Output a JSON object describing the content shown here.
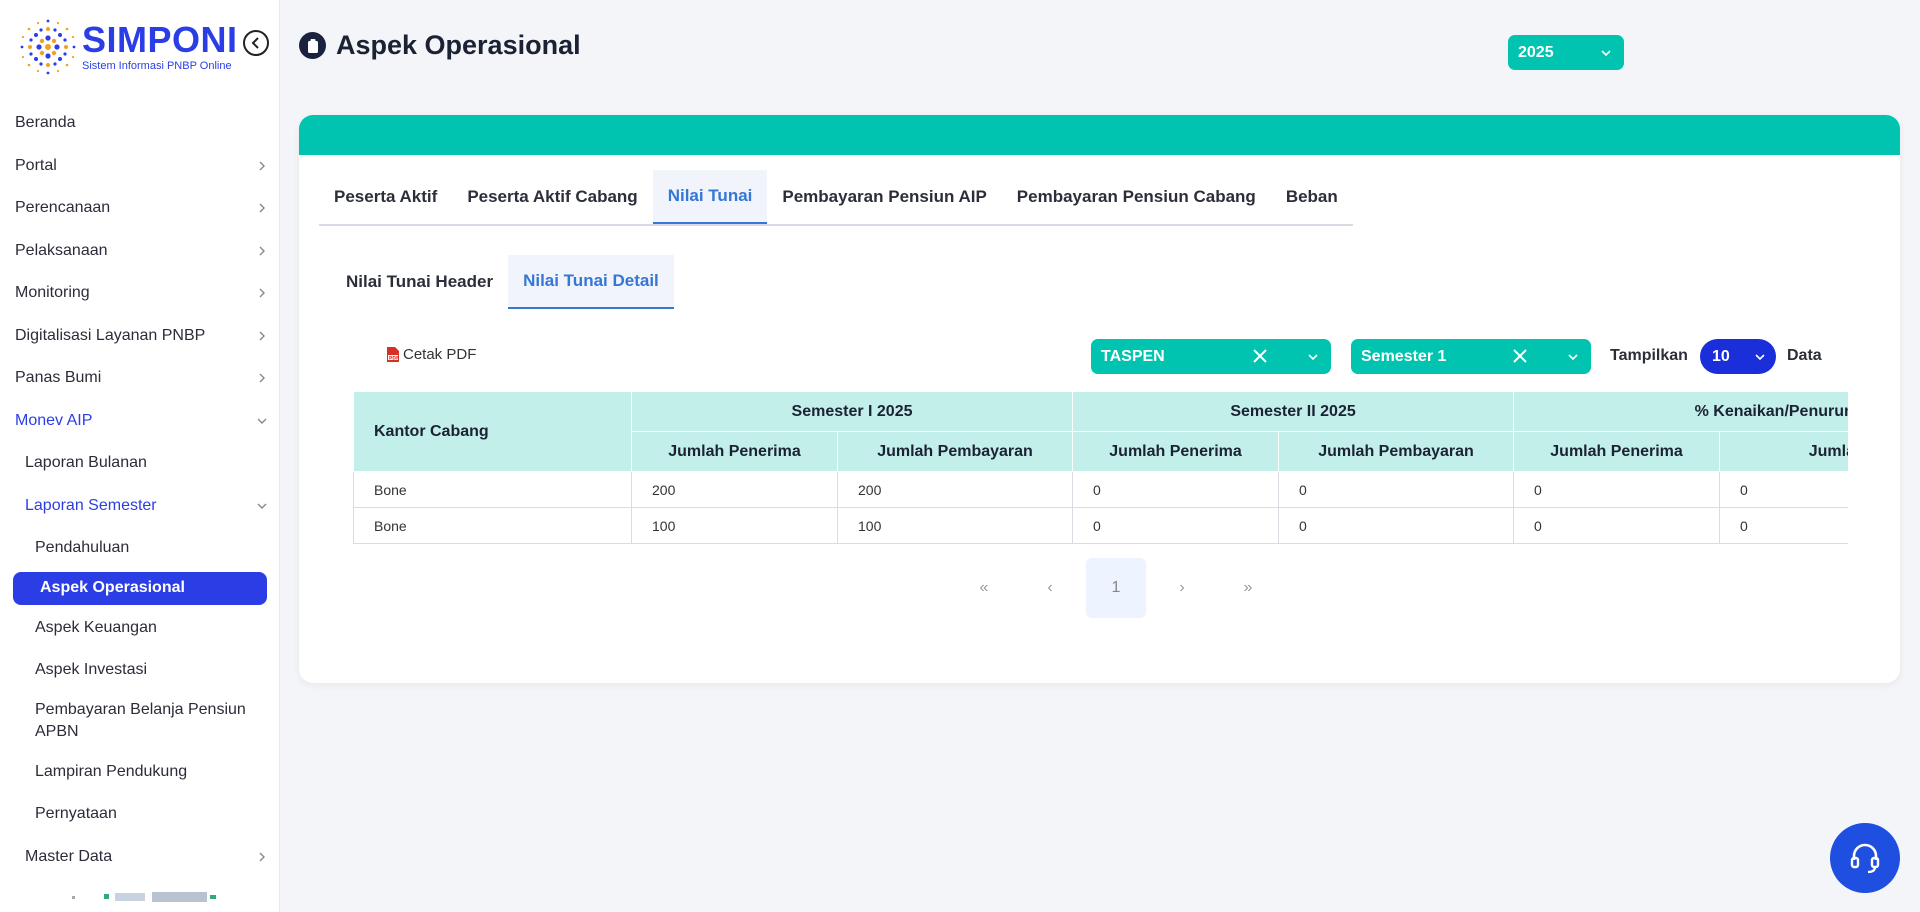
{
  "brand": {
    "name": "SIMPONI",
    "subtitle": "Sistem Informasi PNBP Online"
  },
  "sidebar": {
    "items": [
      {
        "label": "Beranda"
      },
      {
        "label": "Portal"
      },
      {
        "label": "Perencanaan"
      },
      {
        "label": "Pelaksanaan"
      },
      {
        "label": "Monitoring"
      },
      {
        "label": "Digitalisasi Layanan PNBP"
      },
      {
        "label": "Panas Bumi"
      },
      {
        "label": "Monev AIP"
      },
      {
        "label": "Laporan Bulanan"
      },
      {
        "label": "Laporan Semester"
      },
      {
        "label": "Pendahuluan"
      },
      {
        "label": "Aspek Operasional"
      },
      {
        "label": "Aspek Keuangan"
      },
      {
        "label": "Aspek Investasi"
      },
      {
        "label": "Pembayaran Belanja Pensiun APBN"
      },
      {
        "label": "Lampiran Pendukung"
      },
      {
        "label": "Pernyataan"
      },
      {
        "label": "Master Data"
      }
    ]
  },
  "header": {
    "title": "Aspek Operasional",
    "year": "2025"
  },
  "colors": {
    "accent": "#00c4b0",
    "primary": "#2b3ee6",
    "tab_active": "#3576d6",
    "table_header": "#c2efea"
  },
  "tabs": [
    {
      "label": "Peserta Aktif"
    },
    {
      "label": "Peserta Aktif Cabang"
    },
    {
      "label": "Nilai Tunai"
    },
    {
      "label": "Pembayaran Pensiun AIP"
    },
    {
      "label": "Pembayaran Pensiun Cabang"
    },
    {
      "label": "Beban"
    }
  ],
  "subtabs": [
    {
      "label": "Nilai Tunai Header"
    },
    {
      "label": "Nilai Tunai Detail"
    }
  ],
  "toolbar": {
    "pdf_label": "Cetak PDF",
    "filter_company": "TASPEN",
    "filter_semester": "Semester 1",
    "show_label": "Tampilkan",
    "show_value": "10",
    "data_label": "Data"
  },
  "table": {
    "corner_header": "Kantor Cabang",
    "groups": [
      "Semester I 2025",
      "Semester II 2025",
      "% Kenaikan/Penurunan"
    ],
    "subheaders": [
      "Jumlah Penerima",
      "Jumlah Pembayaran",
      "Jumlah Penerima",
      "Jumlah Pembayaran",
      "Jumlah Penerima",
      "Jumlah Pembayaran"
    ],
    "rows": [
      [
        "Bone",
        "200",
        "200",
        "0",
        "0",
        "0",
        "0"
      ],
      [
        "Bone",
        "100",
        "100",
        "0",
        "0",
        "0",
        "0"
      ]
    ]
  },
  "pagination": {
    "first": "«",
    "prev": "‹",
    "current": "1",
    "next": "›",
    "last": "»"
  }
}
